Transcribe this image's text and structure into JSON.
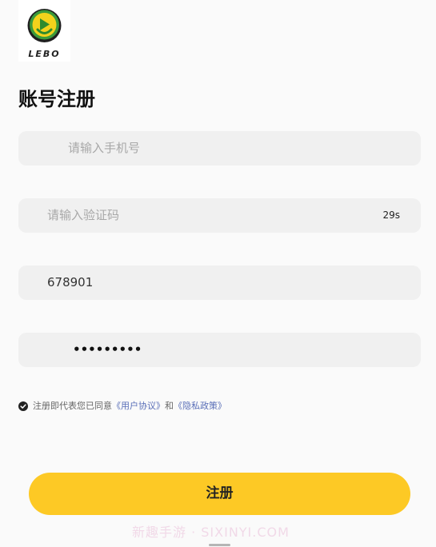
{
  "app": {
    "logo_text": "LEBO",
    "title": "账号注册"
  },
  "form": {
    "phone_placeholder": "请输入手机号",
    "code_placeholder": "请输入验证码",
    "countdown": "29s",
    "invite_value": "678901",
    "password_masked": "•••••••••"
  },
  "agreement": {
    "prefix": "注册即代表您已同意",
    "user_agreement": "《用户协议》",
    "conjunction": "和",
    "privacy_policy": "《隐私政策》"
  },
  "submit_label": "注册",
  "watermark": "新趣手游 · SIXINYI.COM",
  "colors": {
    "accent": "#fdc925",
    "link": "#5a6fb8",
    "field_bg": "#f0f0f0",
    "logo_green": "#3c9a3a",
    "logo_yellow": "#f3d21c"
  }
}
